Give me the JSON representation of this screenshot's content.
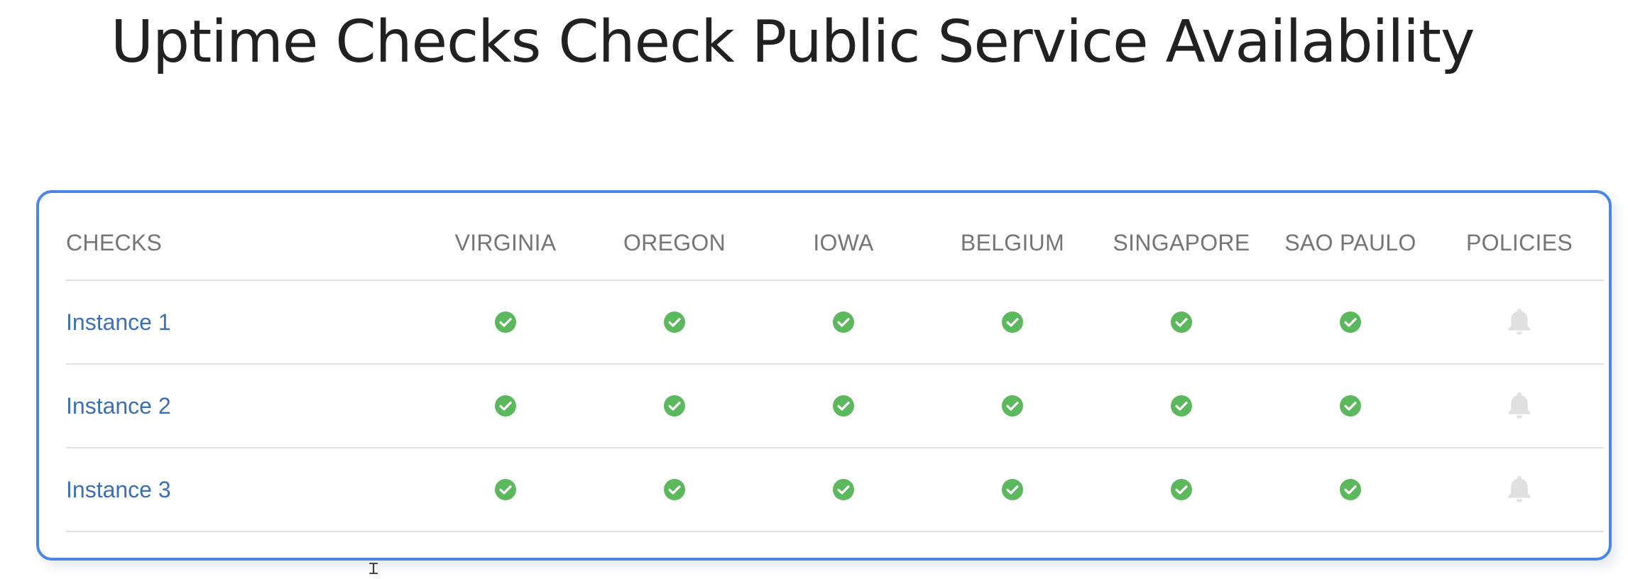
{
  "slide": {
    "title": "Uptime Checks Check Public Service Availability"
  },
  "table": {
    "columns": [
      "CHECKS",
      "VIRGINIA",
      "OREGON",
      "IOWA",
      "BELGIUM",
      "SINGAPORE",
      "SAO PAULO",
      "POLICIES"
    ],
    "rows": [
      {
        "name": "Instance 1",
        "statuses": [
          "ok",
          "ok",
          "ok",
          "ok",
          "ok",
          "ok"
        ],
        "policy_icon": "bell-icon"
      },
      {
        "name": "Instance 2",
        "statuses": [
          "ok",
          "ok",
          "ok",
          "ok",
          "ok",
          "ok"
        ],
        "policy_icon": "bell-icon"
      },
      {
        "name": "Instance 3",
        "statuses": [
          "ok",
          "ok",
          "ok",
          "ok",
          "ok",
          "ok"
        ],
        "policy_icon": "bell-icon"
      }
    ]
  },
  "colors": {
    "border_accent": "#4a86e8",
    "status_ok": "#5cb85c",
    "link": "#3d6fb6",
    "header_text": "#757575",
    "bell_inactive": "#e0e0e0"
  },
  "icons": {
    "status_ok": "check-circle-icon",
    "policy": "bell-icon"
  }
}
